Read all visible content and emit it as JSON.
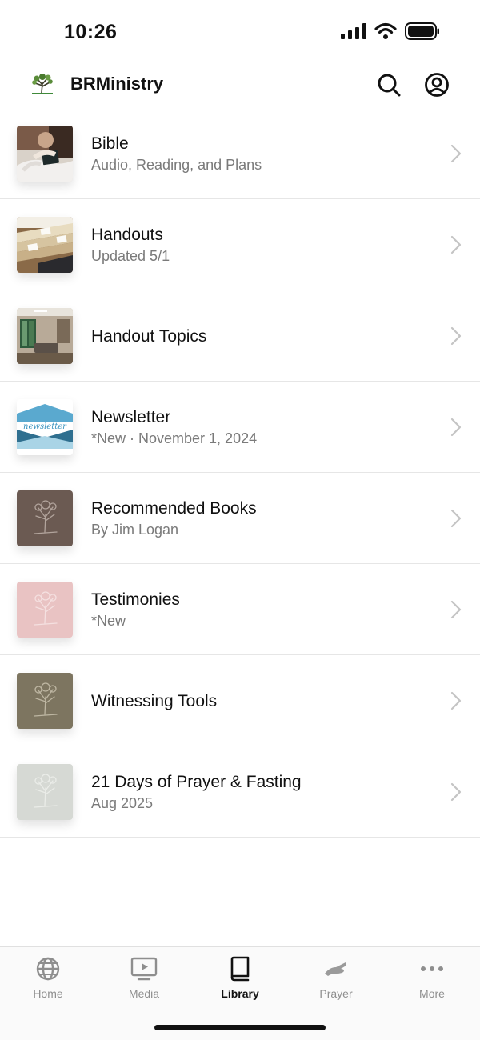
{
  "status": {
    "time": "10:26"
  },
  "header": {
    "title": "BRMinistry"
  },
  "library": {
    "items": [
      {
        "title": "Bible",
        "subtitle": "Audio, Reading, and Plans",
        "thumb": "photo-person-reading-bible"
      },
      {
        "title": "Handouts",
        "subtitle": "Updated 5/1",
        "thumb": "photo-file-folders"
      },
      {
        "title": "Handout Topics",
        "subtitle": "",
        "thumb": "photo-lounge-room"
      },
      {
        "title": "Newsletter",
        "subtitle": "*New · November 1, 2024",
        "thumb": "newsletter-graphic",
        "thumb_text": "newsletter"
      },
      {
        "title": "Recommended Books",
        "subtitle": "By Jim Logan",
        "thumb": "tree-logo-tile",
        "thumb_color": "#6b5a52"
      },
      {
        "title": "Testimonies",
        "subtitle": "*New",
        "thumb": "tree-logo-tile",
        "thumb_color": "#e9c3c3"
      },
      {
        "title": "Witnessing Tools",
        "subtitle": "",
        "thumb": "tree-logo-tile",
        "thumb_color": "#7d7560"
      },
      {
        "title": "21 Days of Prayer & Fasting",
        "subtitle": "Aug 2025",
        "thumb": "tree-logo-tile",
        "thumb_color": "#d6d9d4"
      }
    ]
  },
  "tabs": [
    {
      "label": "Home",
      "icon": "globe-icon",
      "active": false
    },
    {
      "label": "Media",
      "icon": "play-screen-icon",
      "active": false
    },
    {
      "label": "Library",
      "icon": "book-icon",
      "active": true
    },
    {
      "label": "Prayer",
      "icon": "praying-hands-icon",
      "active": false
    },
    {
      "label": "More",
      "icon": "more-dots-icon",
      "active": false
    }
  ],
  "colors": {
    "accent": "#111111",
    "inactive": "#8e8e8e",
    "divider": "#e6e6e6"
  }
}
